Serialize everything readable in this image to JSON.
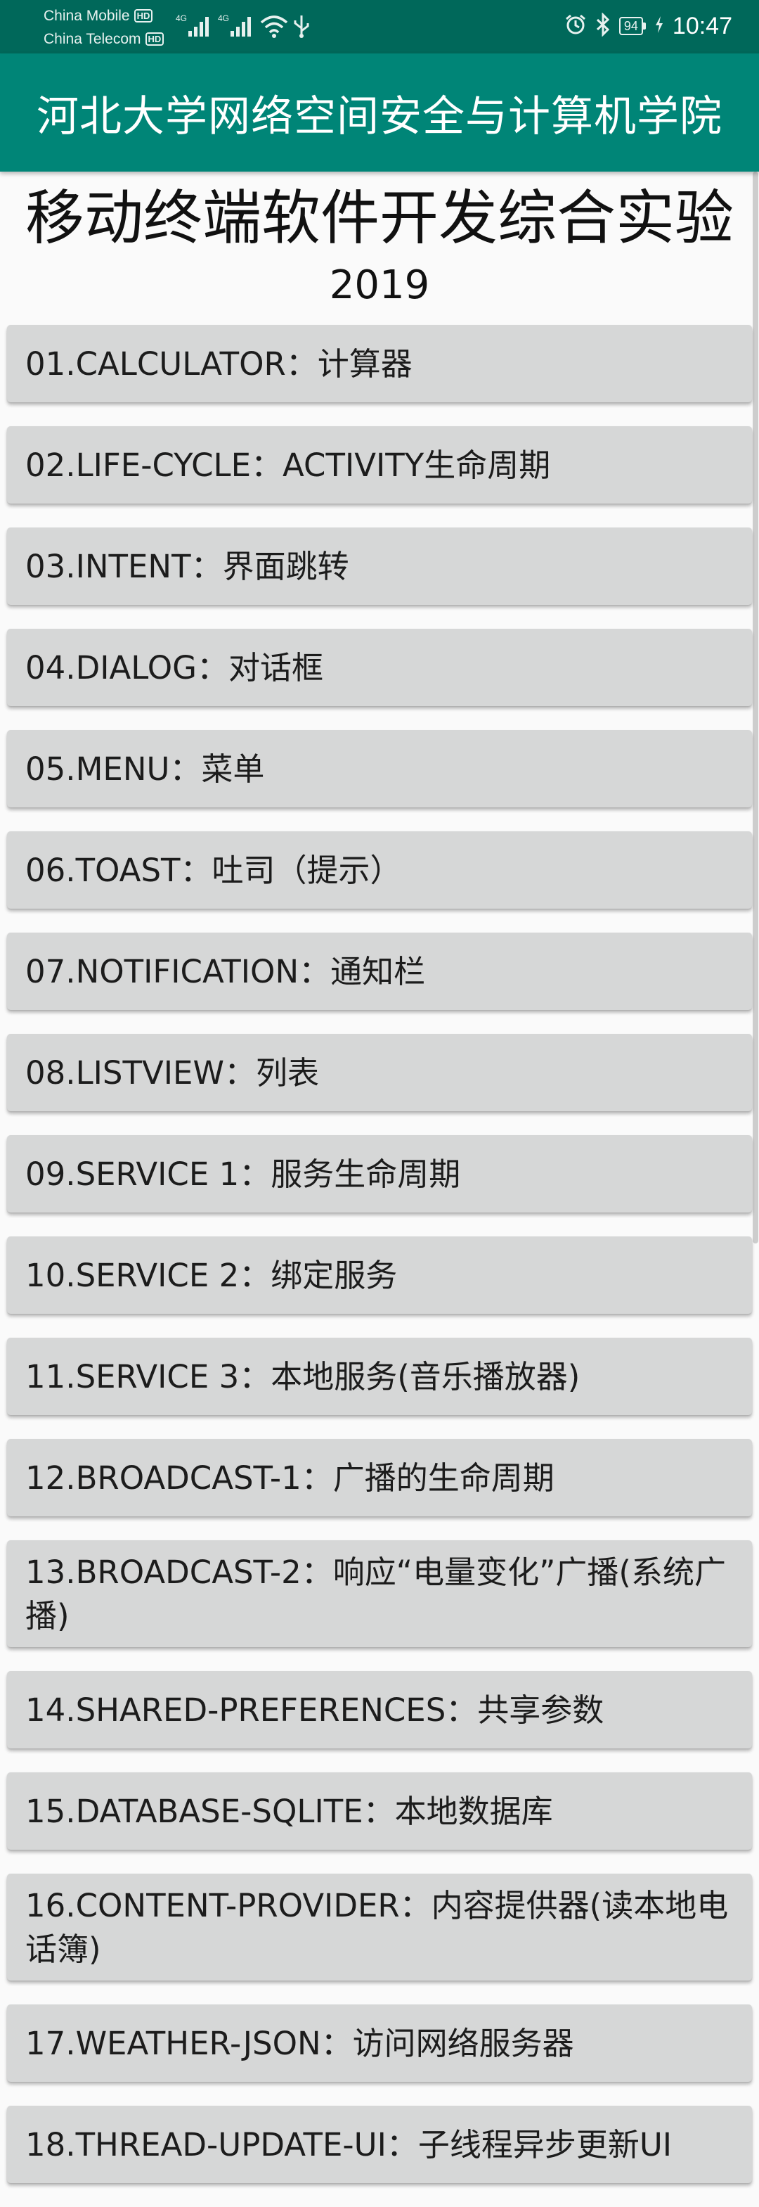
{
  "status_bar": {
    "carrier_1": "China Mobile",
    "carrier_2": "China Telecom",
    "hd_badge": "HD",
    "net_label_1": "4G",
    "net_label_2": "4G",
    "battery_level": "94",
    "time": "10:47",
    "icons": [
      "signal-icon",
      "wifi-icon",
      "usb-icon",
      "alarm-icon",
      "bluetooth-icon",
      "battery-icon",
      "charging-icon"
    ]
  },
  "app_bar": {
    "title": "河北大学网络空间安全与计算机学院"
  },
  "header": {
    "title": "移动终端软件开发综合实验",
    "year": "2019"
  },
  "experiments": [
    {
      "label": "01.CALCULATOR：计算器"
    },
    {
      "label": "02.LIFE-CYCLE：ACTIVITY生命周期"
    },
    {
      "label": "03.INTENT：界面跳转"
    },
    {
      "label": "04.DIALOG：对话框"
    },
    {
      "label": "05.MENU：菜单"
    },
    {
      "label": "06.TOAST：吐司（提示）"
    },
    {
      "label": "07.NOTIFICATION：通知栏"
    },
    {
      "label": "08.LISTVIEW：列表"
    },
    {
      "label": "09.SERVICE 1：服务生命周期"
    },
    {
      "label": "10.SERVICE 2：绑定服务"
    },
    {
      "label": "11.SERVICE 3：本地服务(音乐播放器)"
    },
    {
      "label": "12.BROADCAST-1：广播的生命周期"
    },
    {
      "label": "13.BROADCAST-2：响应“电量变化”广播(系统广播)"
    },
    {
      "label": "14.SHARED-PREFERENCES：共享参数"
    },
    {
      "label": "15.DATABASE-SQLITE：本地数据库"
    },
    {
      "label": "16.CONTENT-PROVIDER：内容提供器(读本地电话簿)"
    },
    {
      "label": "17.WEATHER-JSON：访问网络服务器"
    },
    {
      "label": "18.THREAD-UPDATE-UI：子线程异步更新UI"
    }
  ],
  "colors": {
    "status_bar": "#00685a",
    "app_bar": "#008577",
    "button_bg": "#d6d7d7",
    "page_bg": "#fafafa"
  }
}
